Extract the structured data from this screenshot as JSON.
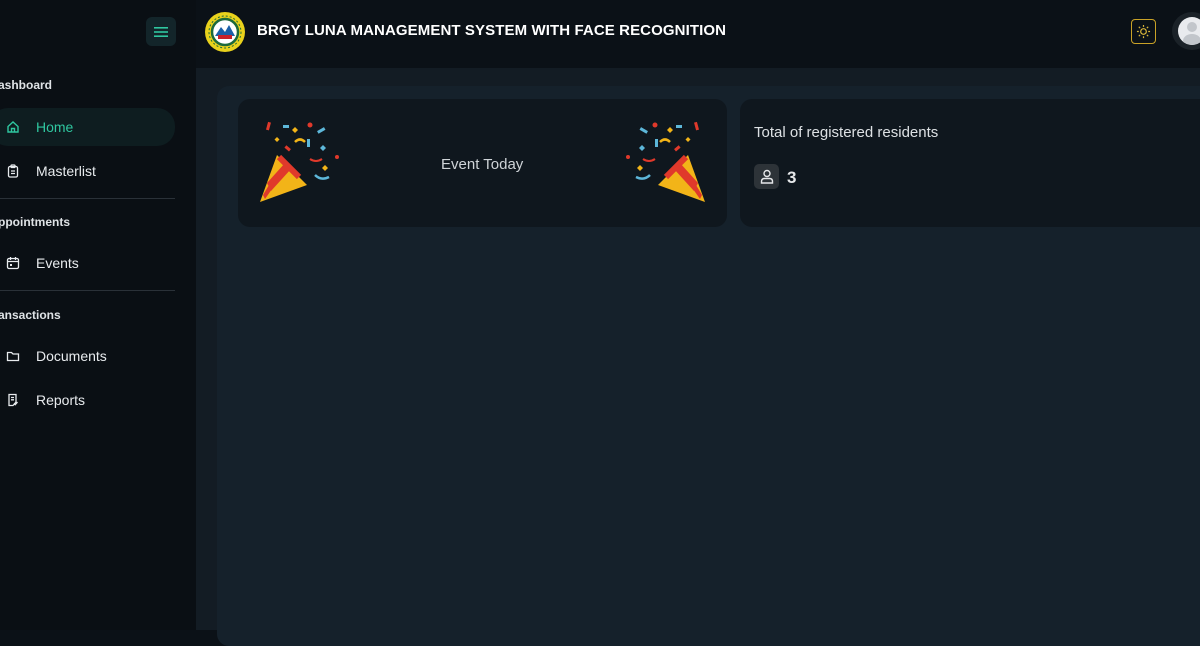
{
  "header": {
    "title": "BRGY LUNA MANAGEMENT SYSTEM WITH FACE RECOGNITION"
  },
  "sidebar": {
    "sections": [
      {
        "label": "ashboard"
      },
      {
        "label": "ppointments"
      },
      {
        "label": "ansactions"
      }
    ],
    "items": [
      {
        "label": "Home",
        "icon": "home-icon",
        "active": true
      },
      {
        "label": "Masterlist",
        "icon": "clipboard-icon"
      },
      {
        "label": "Events",
        "icon": "calendar-icon"
      },
      {
        "label": "Documents",
        "icon": "folder-icon"
      },
      {
        "label": "Reports",
        "icon": "report-icon"
      }
    ]
  },
  "cards": {
    "event": {
      "label": "Event Today",
      "icon": "party-popper-icon"
    },
    "residents": {
      "label": "Total of registered residents",
      "count": "3",
      "icon": "user-icon"
    }
  },
  "colors": {
    "accent": "#2fc7a0",
    "theme_button_border": "#c9a227",
    "logo": "#e9d21c"
  }
}
